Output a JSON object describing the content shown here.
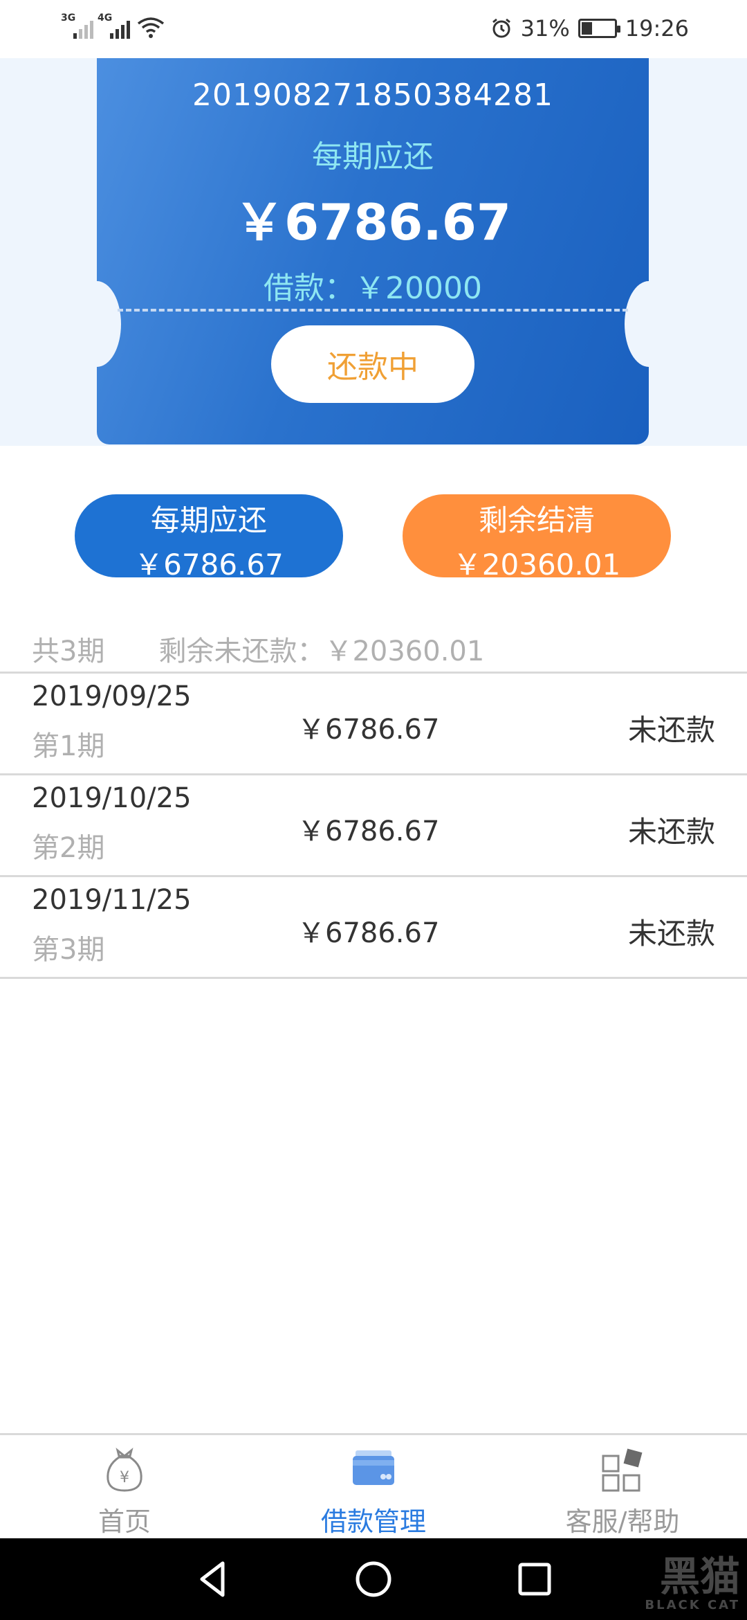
{
  "status_bar": {
    "net1": "3G",
    "net2": "4G",
    "battery_percent": "31%",
    "battery_level": 0.31,
    "time": "19:26"
  },
  "loan_card": {
    "order_number": "201908271850384281",
    "per_period_label": "每期应还",
    "per_period_amount": "￥6786.67",
    "loan_amount_text": "借款：￥20000",
    "status_button": "还款中"
  },
  "actions": {
    "installment": {
      "label": "每期应还",
      "amount": "￥6786.67"
    },
    "settle": {
      "label": "剩余结清",
      "amount": "￥20360.01"
    }
  },
  "summary": {
    "total_periods": "共3期",
    "remaining_unpaid": "剩余未还款：￥20360.01"
  },
  "repayments": [
    {
      "date": "2019/09/25",
      "period": "第1期",
      "amount": "￥6786.67",
      "status": "未还款"
    },
    {
      "date": "2019/10/25",
      "period": "第2期",
      "amount": "￥6786.67",
      "status": "未还款"
    },
    {
      "date": "2019/11/25",
      "period": "第3期",
      "amount": "￥6786.67",
      "status": "未还款"
    }
  ],
  "bottom_nav": {
    "items": [
      {
        "label": "首页",
        "icon": "money-bag-icon",
        "active": false
      },
      {
        "label": "借款管理",
        "icon": "card-icon",
        "active": true
      },
      {
        "label": "客服/帮助",
        "icon": "grid-icon",
        "active": false
      }
    ]
  },
  "watermark": {
    "main": "黑猫",
    "sub": "BLACK CAT"
  },
  "colors": {
    "primary_blue": "#1e72d3",
    "orange": "#ff8f3d",
    "status_text": "#f0a035",
    "accent_cyan": "#8ee6f2",
    "active_nav": "#2a7be0"
  }
}
